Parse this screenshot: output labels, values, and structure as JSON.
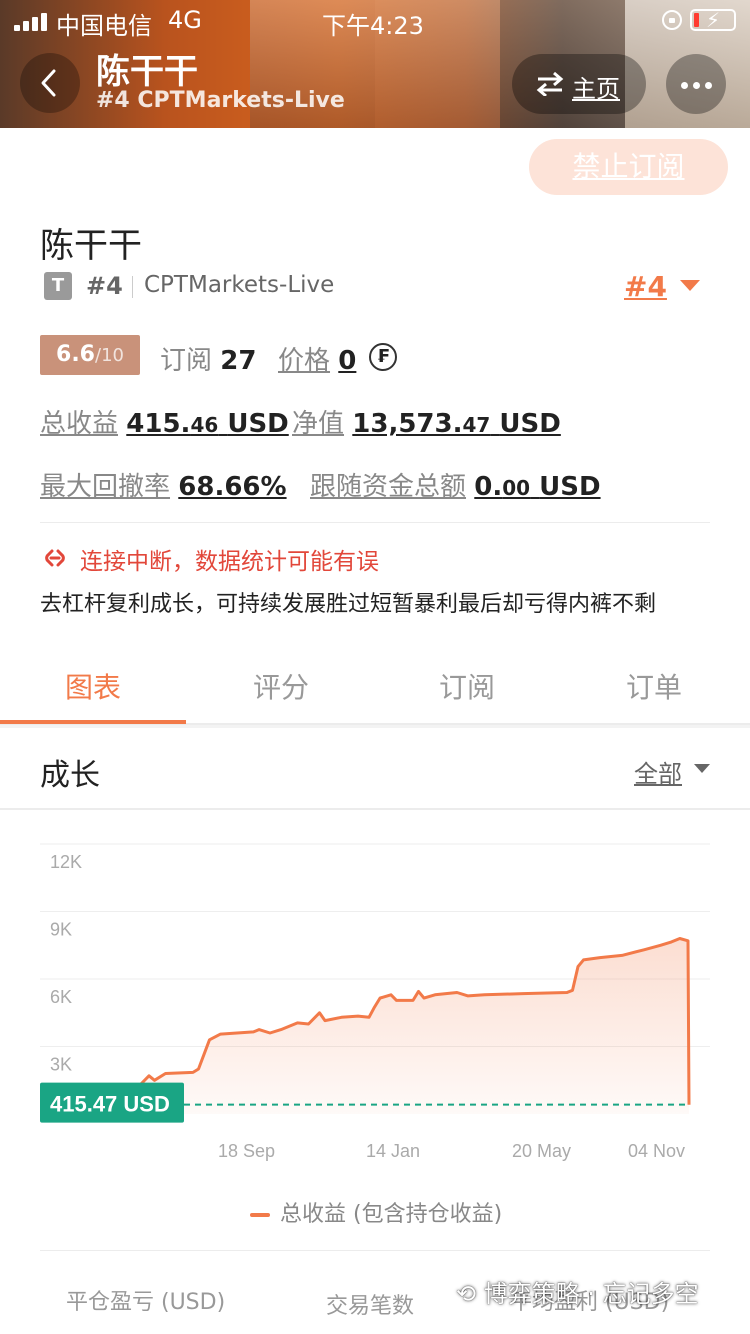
{
  "status_bar": {
    "carrier": "中国电信",
    "network": "4G",
    "time": "下午4:23"
  },
  "header": {
    "title": "陈干干",
    "subtitle": "#4 CPTMarkets-Live",
    "home_label": "主页"
  },
  "profile": {
    "unsubscribe_label": "禁止订阅",
    "name": "陈干干",
    "badge": "T",
    "rank": "#4",
    "server": "CPTMarkets-Live",
    "rank_selector": "#4",
    "score": "6.6",
    "score_max": "/10",
    "subscribe_label": "订阅",
    "subscribe_count": "27",
    "price_label": "价格",
    "price_value": "0",
    "total_profit_label": "总收益",
    "total_profit_int": "415.",
    "total_profit_dec": "46",
    "total_profit_unit": "USD",
    "equity_label": "净值",
    "equity_int": "13,573.",
    "equity_dec": "47",
    "equity_unit": "USD",
    "max_drawdown_label": "最大回撤率",
    "max_drawdown": "68.66%",
    "follow_funds_label": "跟随资金总额",
    "follow_funds_int": "0.",
    "follow_funds_dec": "00",
    "follow_funds_unit": "USD",
    "warning": "连接中断，数据统计可能有误",
    "description": "去杠杆复利成长，可持续发展胜过短暂暴利最后却亏得内裤不剩"
  },
  "tabs": [
    {
      "label": "图表",
      "active": true
    },
    {
      "label": "评分",
      "active": false
    },
    {
      "label": "订阅",
      "active": false
    },
    {
      "label": "订单",
      "active": false
    }
  ],
  "growth": {
    "title": "成长",
    "range_label": "全部"
  },
  "chart_data": {
    "type": "area",
    "ylim": [
      0,
      12000
    ],
    "yticks": [
      "12K",
      "9K",
      "6K",
      "3K"
    ],
    "xticks": [
      "18 Sep",
      "14 Jan",
      "20 May",
      "04 Nov"
    ],
    "current_value_label": "415.47 USD",
    "current_value": 415.47,
    "legend": "总收益 (包含持仓收益)",
    "series": [
      {
        "name": "总收益 (包含持仓收益)",
        "points": [
          [
            0,
            1200
          ],
          [
            0.02,
            1700
          ],
          [
            0.03,
            1500
          ],
          [
            0.05,
            1800
          ],
          [
            0.1,
            1850
          ],
          [
            0.11,
            2000
          ],
          [
            0.13,
            3300
          ],
          [
            0.15,
            3550
          ],
          [
            0.18,
            3600
          ],
          [
            0.21,
            3650
          ],
          [
            0.22,
            3750
          ],
          [
            0.24,
            3600
          ],
          [
            0.26,
            3750
          ],
          [
            0.29,
            4050
          ],
          [
            0.31,
            4000
          ],
          [
            0.33,
            4500
          ],
          [
            0.34,
            4150
          ],
          [
            0.37,
            4300
          ],
          [
            0.4,
            4350
          ],
          [
            0.42,
            4300
          ],
          [
            0.43,
            4750
          ],
          [
            0.44,
            5150
          ],
          [
            0.46,
            5300
          ],
          [
            0.47,
            5050
          ],
          [
            0.5,
            5050
          ],
          [
            0.51,
            5450
          ],
          [
            0.52,
            5150
          ],
          [
            0.54,
            5300
          ],
          [
            0.58,
            5400
          ],
          [
            0.6,
            5250
          ],
          [
            0.63,
            5300
          ],
          [
            0.7,
            5350
          ],
          [
            0.78,
            5400
          ],
          [
            0.79,
            5500
          ],
          [
            0.8,
            6550
          ],
          [
            0.81,
            6850
          ],
          [
            0.84,
            6950
          ],
          [
            0.88,
            7050
          ],
          [
            0.92,
            7300
          ],
          [
            0.95,
            7500
          ],
          [
            0.97,
            7650
          ],
          [
            0.985,
            7800
          ],
          [
            1.0,
            7700
          ],
          [
            1.005,
            415.47
          ]
        ]
      }
    ],
    "baseline_color": "#1aa584",
    "line_color": "#f27a49"
  },
  "bottom_stats": {
    "closed_pnl_label": "平仓盈亏 (USD)",
    "trades_label": "交易笔数",
    "avg_pnl_label": "平均盈利 (USD)"
  },
  "watermark": "博弈策略 · 忘记多空"
}
